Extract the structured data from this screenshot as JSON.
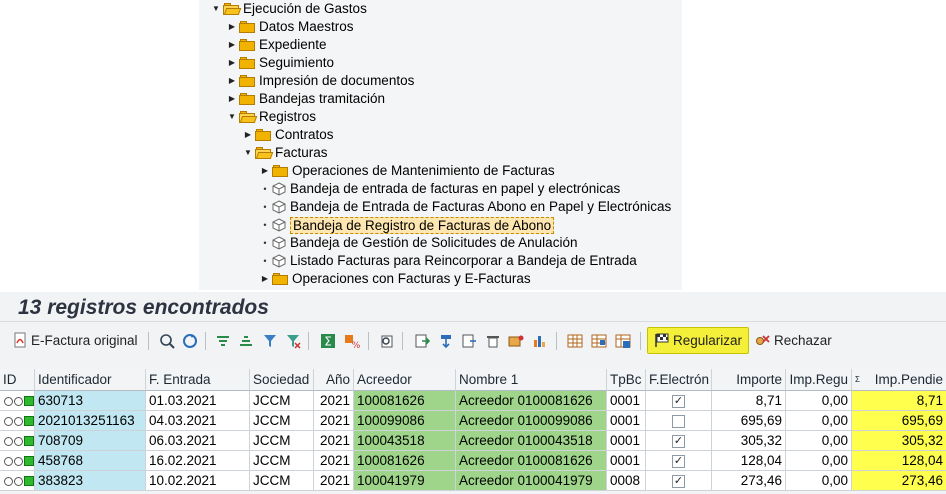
{
  "tree": {
    "items": [
      {
        "label": "Ejecución de Gastos",
        "kind": "folder-open",
        "arrow": "down"
      },
      {
        "label": "Datos Maestros",
        "kind": "folder",
        "arrow": "right"
      },
      {
        "label": "Expediente",
        "kind": "folder",
        "arrow": "right"
      },
      {
        "label": "Seguimiento",
        "kind": "folder",
        "arrow": "right"
      },
      {
        "label": "Impresión de documentos",
        "kind": "folder",
        "arrow": "right"
      },
      {
        "label": "Bandejas tramitación",
        "kind": "folder",
        "arrow": "right"
      },
      {
        "label": "Registros",
        "kind": "folder-open",
        "arrow": "down"
      },
      {
        "label": "Contratos",
        "kind": "folder",
        "arrow": "right"
      },
      {
        "label": "Facturas",
        "kind": "folder-open",
        "arrow": "down"
      },
      {
        "label": "Operaciones de Mantenimiento de Facturas",
        "kind": "folder",
        "arrow": "right"
      },
      {
        "label": "Bandeja de entrada de facturas en papel y electrónicas",
        "kind": "transaction",
        "arrow": "bullet"
      },
      {
        "label": "Bandeja de Entrada de Facturas Abono en Papel y Electrónicas",
        "kind": "transaction",
        "arrow": "bullet"
      },
      {
        "label": "Bandeja de Registro de Facturas de Abono",
        "kind": "transaction",
        "arrow": "bullet",
        "selected": true
      },
      {
        "label": "Bandeja de Gestión de Solicitudes de Anulación",
        "kind": "transaction",
        "arrow": "bullet"
      },
      {
        "label": "Listado Facturas para Reincorporar a Bandeja de Entrada",
        "kind": "transaction",
        "arrow": "bullet"
      },
      {
        "label": "Operaciones con Facturas y E-Facturas",
        "kind": "folder",
        "arrow": "right"
      }
    ]
  },
  "results": {
    "title": "13 registros encontrados"
  },
  "toolbar": {
    "efactura_label": "E-Factura original",
    "regularizar_label": "Regularizar",
    "rechazar_label": "Rechazar"
  },
  "table": {
    "headers": {
      "id": "ID",
      "identificador": "Identificador",
      "fentrada": "F. Entrada",
      "sociedad": "Sociedad",
      "anio": "Año",
      "acreedor": "Acreedor",
      "nombre": "Nombre 1",
      "tpbc": "TpBc",
      "felec": "F.Electrón",
      "importe": "Importe",
      "impregu": "Imp.Regu",
      "sum_marker": "Σ",
      "imppend": "Imp.Pendie"
    },
    "rows": [
      {
        "identificador": "630713",
        "fentrada": "01.03.2021",
        "sociedad": "JCCM",
        "anio": "2021",
        "acreedor": "100081626",
        "nombre": "Acreedor  0100081626",
        "tpbc": "0001",
        "felec": true,
        "importe": "8,71",
        "impregu": "0,00",
        "imppend": "8,71"
      },
      {
        "identificador": "2021013251163",
        "fentrada": "04.03.2021",
        "sociedad": "JCCM",
        "anio": "2021",
        "acreedor": "100099086",
        "nombre": "Acreedor  0100099086",
        "tpbc": "0001",
        "felec": false,
        "importe": "695,69",
        "impregu": "0,00",
        "imppend": "695,69"
      },
      {
        "identificador": "708709",
        "fentrada": "06.03.2021",
        "sociedad": "JCCM",
        "anio": "2021",
        "acreedor": "100043518",
        "nombre": "Acreedor  0100043518",
        "tpbc": "0001",
        "felec": true,
        "importe": "305,32",
        "impregu": "0,00",
        "imppend": "305,32"
      },
      {
        "identificador": "458768",
        "fentrada": "16.02.2021",
        "sociedad": "JCCM",
        "anio": "2021",
        "acreedor": "100081626",
        "nombre": "Acreedor  0100081626",
        "tpbc": "0001",
        "felec": true,
        "importe": "128,04",
        "impregu": "0,00",
        "imppend": "128,04"
      },
      {
        "identificador": "383823",
        "fentrada": "10.02.2021",
        "sociedad": "JCCM",
        "anio": "2021",
        "acreedor": "100041979",
        "nombre": "Acreedor  0100041979",
        "tpbc": "0008",
        "felec": true,
        "importe": "273,46",
        "impregu": "0,00",
        "imppend": "273,46"
      }
    ]
  },
  "colors": {
    "identificador_bg": "#c1e7f3",
    "acreedor_bg": "#9ed58a",
    "pending_bg": "#ffff4d",
    "regularizar_highlight": "#f4f03a"
  }
}
